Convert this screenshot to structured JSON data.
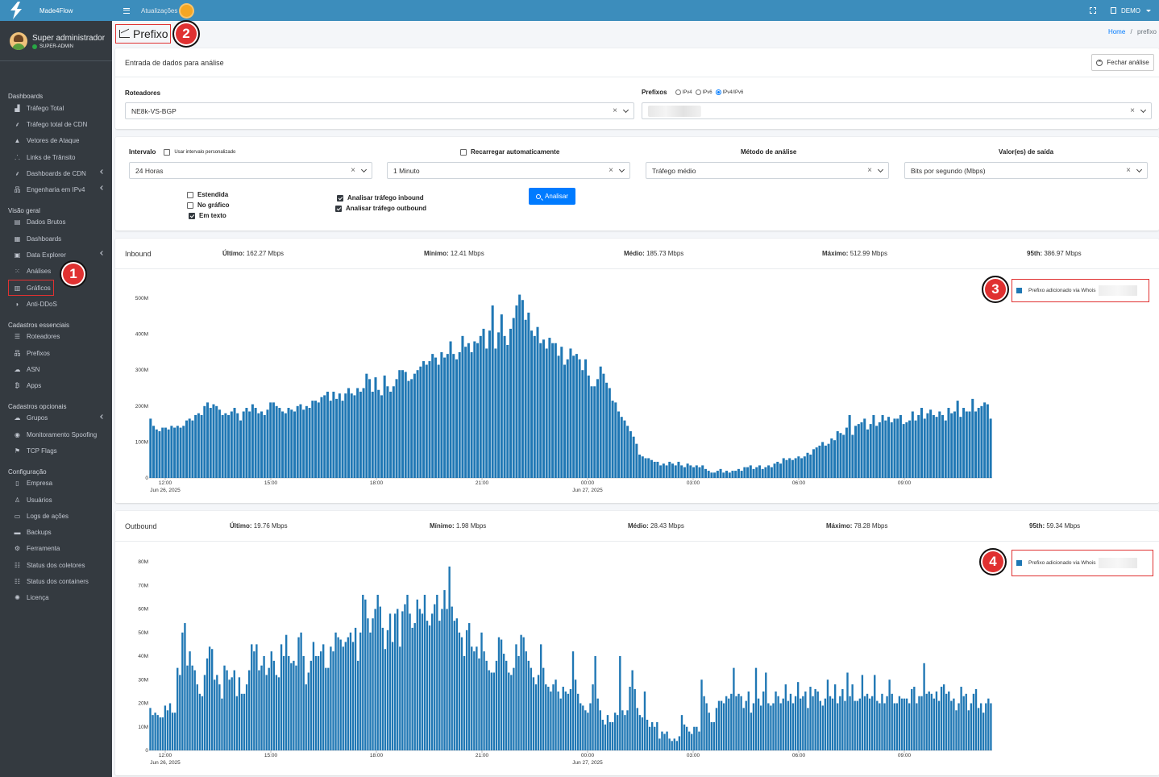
{
  "brand": {
    "name": "Made4Flow"
  },
  "user": {
    "name": "Super administrador",
    "role": "SUPER-ADMIN"
  },
  "topbar": {
    "updates_label": "Atualizações",
    "account_label": "DEMO"
  },
  "sidebar": {
    "sections": [
      {
        "header": "Dashboards",
        "items": [
          {
            "label": "Tráfego Total",
            "icon": "chart-area-icon",
            "chevron": false
          },
          {
            "label": "Tráfego total de CDN",
            "icon": "broadcast-icon",
            "chevron": false
          },
          {
            "label": "Vetores de Ataque",
            "icon": "warning-icon",
            "chevron": false
          },
          {
            "label": "Links de Trânsito",
            "icon": "network-icon",
            "chevron": false
          },
          {
            "label": "Dashboards de CDN",
            "icon": "broadcast-icon",
            "chevron": true
          },
          {
            "label": "Engenharia em IPv4",
            "icon": "sitemap-icon",
            "chevron": true
          }
        ]
      },
      {
        "header": "Visão geral",
        "items": [
          {
            "label": "Dados Brutos",
            "icon": "file-icon",
            "chevron": false
          },
          {
            "label": "Dashboards",
            "icon": "calendar-icon",
            "chevron": false
          },
          {
            "label": "Data Explorer",
            "icon": "explorer-icon",
            "chevron": true
          },
          {
            "label": "Análises",
            "icon": "grid-icon",
            "chevron": false
          },
          {
            "label": "Gráficos",
            "icon": "bar-chart-icon",
            "chevron": false,
            "highlighted": true
          },
          {
            "label": "Anti-DDoS",
            "icon": "shield-icon",
            "chevron": false
          }
        ]
      },
      {
        "header": "Cadastros essenciais",
        "items": [
          {
            "label": "Roteadores",
            "icon": "server-icon",
            "chevron": false
          },
          {
            "label": "Prefixos",
            "icon": "sitemap-icon",
            "chevron": false
          },
          {
            "label": "ASN",
            "icon": "cloud-icon",
            "chevron": false
          },
          {
            "label": "Apps",
            "icon": "bitcoin-icon",
            "chevron": false
          }
        ]
      },
      {
        "header": "Cadastros opcionais",
        "items": [
          {
            "label": "Grupos",
            "icon": "cloud-group-icon",
            "chevron": true
          },
          {
            "label": "Monitoramento Spoofing",
            "icon": "user-secret-icon",
            "chevron": false
          },
          {
            "label": "TCP Flags",
            "icon": "flag-icon",
            "chevron": false
          }
        ]
      },
      {
        "header": "Configuração",
        "items": [
          {
            "label": "Empresa",
            "icon": "building-icon",
            "chevron": false
          },
          {
            "label": "Usuários",
            "icon": "user-icon",
            "chevron": false
          },
          {
            "label": "Logs de ações",
            "icon": "folder-icon",
            "chevron": false
          },
          {
            "label": "Backups",
            "icon": "database-icon",
            "chevron": false
          },
          {
            "label": "Ferramenta",
            "icon": "gear-icon",
            "chevron": false
          },
          {
            "label": "Status dos coletores",
            "icon": "list-icon",
            "chevron": false
          },
          {
            "label": "Status dos containers",
            "icon": "list-icon",
            "chevron": false
          },
          {
            "label": "Licença",
            "icon": "certificate-icon",
            "chevron": false
          }
        ]
      }
    ]
  },
  "page": {
    "title": "Prefixo",
    "breadcrumb_home": "Home",
    "breadcrumb_sep": "/",
    "breadcrumb_current": "prefixo"
  },
  "annotations": [
    "1",
    "2",
    "3",
    "4"
  ],
  "form": {
    "header": "Entrada de dados para análise",
    "close_button": "Fechar análise",
    "routers_label": "Roteadores",
    "routers_value": "NE8k-VS-BGP",
    "prefixes_label": "Prefixos",
    "prefix_options": [
      "IPv4",
      "IPv6",
      "IPv4/IPv6"
    ],
    "prefix_selected": "IPv4/IPv6",
    "interval_label": "Intervalo",
    "custom_interval_label": "Usar intervalo personalizado",
    "interval_value": "24 Horas",
    "reload_label": "Recarregar automaticamente",
    "reload_value": "1 Minuto",
    "method_label": "Método de análise",
    "method_value": "Tráfego médio",
    "output_label": "Valor(es) de saída",
    "output_value": "Bits por segundo (Mbps)",
    "options": [
      {
        "label": "Estendida",
        "checked": false
      },
      {
        "label": "No gráfico",
        "checked": false
      },
      {
        "label": "Em texto",
        "checked": true
      }
    ],
    "traffic_options": [
      {
        "label": "Analisar tráfego inbound",
        "checked": true
      },
      {
        "label": "Analisar tráfego outbound",
        "checked": true
      }
    ],
    "analyze_button": "Analisar"
  },
  "inbound": {
    "title": "Inbound",
    "stats": [
      {
        "label": "Último:",
        "value": "162.27 Mbps"
      },
      {
        "label": "Mínimo:",
        "value": "12.41 Mbps"
      },
      {
        "label": "Médio:",
        "value": "185.73 Mbps"
      },
      {
        "label": "Máximo:",
        "value": "512.99 Mbps"
      },
      {
        "label": "95th:",
        "value": "386.97 Mbps"
      }
    ],
    "legend": "Prefixo adicionado via Whois"
  },
  "outbound": {
    "title": "Outbound",
    "stats": [
      {
        "label": "Último:",
        "value": "19.76 Mbps"
      },
      {
        "label": "Mínimo:",
        "value": "1.98 Mbps"
      },
      {
        "label": "Médio:",
        "value": "28.43 Mbps"
      },
      {
        "label": "Máximo:",
        "value": "78.28 Mbps"
      },
      {
        "label": "95th:",
        "value": "59.34 Mbps"
      }
    ],
    "legend": "Prefixo adicionado via Whois"
  },
  "chart_data": [
    {
      "type": "bar",
      "title": "Inbound",
      "unit": "Mbps",
      "color": "#1f77b4",
      "ylim": [
        0,
        500
      ],
      "yticks": [
        "0",
        "100M",
        "200M",
        "300M",
        "400M",
        "500M"
      ],
      "xticks": [
        "12:00",
        "15:00",
        "18:00",
        "21:00",
        "00:00",
        "03:00",
        "06:00",
        "09:00"
      ],
      "xtick_sublabels": [
        "Jun 26, 2025",
        "",
        "",
        "",
        "Jun 27, 2025",
        "",
        "",
        ""
      ],
      "legend": [
        "Prefixo adicionado via Whois"
      ],
      "values": [
        165,
        145,
        135,
        130,
        140,
        140,
        135,
        145,
        140,
        145,
        140,
        145,
        160,
        165,
        160,
        175,
        180,
        175,
        200,
        210,
        195,
        205,
        200,
        190,
        175,
        180,
        175,
        185,
        195,
        180,
        160,
        185,
        195,
        185,
        205,
        195,
        180,
        185,
        175,
        190,
        210,
        210,
        200,
        195,
        185,
        180,
        195,
        190,
        185,
        200,
        205,
        190,
        200,
        195,
        215,
        215,
        210,
        225,
        230,
        240,
        215,
        240,
        220,
        235,
        215,
        235,
        250,
        235,
        230,
        250,
        240,
        250,
        290,
        275,
        240,
        280,
        245,
        230,
        285,
        255,
        240,
        255,
        275,
        300,
        300,
        295,
        270,
        275,
        290,
        300,
        310,
        325,
        315,
        325,
        345,
        335,
        315,
        350,
        335,
        345,
        380,
        345,
        330,
        350,
        395,
        365,
        375,
        350,
        380,
        375,
        395,
        415,
        360,
        410,
        480,
        360,
        405,
        455,
        395,
        370,
        415,
        445,
        480,
        510,
        495,
        440,
        460,
        410,
        395,
        420,
        375,
        385,
        360,
        390,
        375,
        375,
        340,
        365,
        315,
        330,
        360,
        340,
        345,
        330,
        300,
        330,
        285,
        255,
        255,
        275,
        310,
        290,
        265,
        250,
        215,
        210,
        185,
        170,
        160,
        145,
        130,
        115,
        95,
        65,
        60,
        55,
        55,
        50,
        45,
        45,
        35,
        40,
        35,
        45,
        40,
        35,
        45,
        35,
        30,
        40,
        35,
        30,
        35,
        30,
        35,
        25,
        20,
        15,
        15,
        20,
        25,
        15,
        20,
        15,
        20,
        20,
        25,
        20,
        30,
        30,
        35,
        25,
        30,
        35,
        25,
        30,
        35,
        30,
        40,
        45,
        40,
        55,
        50,
        55,
        50,
        55,
        60,
        55,
        60,
        70,
        65,
        80,
        85,
        90,
        100,
        90,
        95,
        110,
        105,
        130,
        125,
        120,
        140,
        175,
        120,
        145,
        150,
        155,
        165,
        135,
        150,
        175,
        145,
        155,
        175,
        160,
        170,
        155,
        165,
        165,
        175,
        150,
        155,
        160,
        185,
        160,
        175,
        195,
        165,
        180,
        190,
        175,
        170,
        185,
        175,
        160,
        195,
        180,
        185,
        215,
        170,
        195,
        185,
        185,
        220,
        185,
        195,
        200,
        210,
        205,
        165
      ]
    },
    {
      "type": "bar",
      "title": "Outbound",
      "unit": "Mbps",
      "color": "#1f77b4",
      "ylim": [
        0,
        80
      ],
      "yticks": [
        "0",
        "10M",
        "20M",
        "30M",
        "40M",
        "50M",
        "60M",
        "70M",
        "80M"
      ],
      "xticks": [
        "12:00",
        "15:00",
        "18:00",
        "21:00",
        "00:00",
        "03:00",
        "06:00",
        "09:00"
      ],
      "xtick_sublabels": [
        "Jun 26, 2025",
        "",
        "",
        "",
        "Jun 27, 2025",
        "",
        "",
        ""
      ],
      "legend": [
        "Prefixo adicionado via Whois"
      ],
      "values": [
        18,
        15,
        16,
        15,
        14,
        14,
        19,
        17,
        20,
        16,
        16,
        35,
        32,
        50,
        54,
        36,
        42,
        36,
        34,
        28,
        24,
        23,
        32,
        39,
        44,
        43,
        30,
        32,
        28,
        22,
        36,
        34,
        30,
        31,
        34,
        23,
        31,
        24,
        24,
        28,
        34,
        45,
        42,
        45,
        34,
        36,
        40,
        32,
        35,
        42,
        38,
        32,
        31,
        45,
        40,
        49,
        40,
        37,
        38,
        36,
        48,
        50,
        40,
        28,
        33,
        38,
        46,
        40,
        40,
        42,
        45,
        35,
        35,
        44,
        42,
        50,
        48,
        47,
        44,
        46,
        48,
        50,
        46,
        52,
        38,
        50,
        66,
        64,
        56,
        50,
        56,
        60,
        66,
        61,
        52,
        43,
        51,
        58,
        46,
        58,
        60,
        44,
        59,
        62,
        66,
        58,
        52,
        54,
        64,
        60,
        58,
        66,
        55,
        53,
        58,
        62,
        66,
        55,
        60,
        68,
        60,
        78,
        61,
        55,
        56,
        50,
        48,
        40,
        51,
        54,
        44,
        42,
        44,
        39,
        50,
        42,
        38,
        34,
        33,
        33,
        38,
        48,
        47,
        41,
        38,
        33,
        32,
        35,
        45,
        40,
        49,
        48,
        42,
        38,
        35,
        31,
        28,
        32,
        45,
        35,
        28,
        27,
        25,
        28,
        30,
        25,
        22,
        27,
        25,
        24,
        26,
        42,
        30,
        24,
        20,
        19,
        17,
        16,
        20,
        28,
        40,
        22,
        17,
        13,
        11,
        15,
        12,
        12,
        16,
        15,
        40,
        17,
        15,
        17,
        27,
        34,
        26,
        18,
        15,
        14,
        25,
        13,
        10,
        12,
        10,
        12,
        5,
        8,
        7,
        8,
        5,
        4,
        5,
        4,
        6,
        15,
        11,
        10,
        8,
        7,
        10,
        10,
        8,
        30,
        23,
        20,
        16,
        12,
        12,
        18,
        21,
        21,
        20,
        23,
        22,
        24,
        35,
        23,
        24,
        23,
        18,
        21,
        25,
        16,
        20,
        35,
        22,
        19,
        25,
        33,
        20,
        19,
        20,
        25,
        23,
        20,
        22,
        28,
        21,
        24,
        20,
        23,
        29,
        22,
        23,
        25,
        18,
        27,
        23,
        26,
        25,
        21,
        19,
        22,
        30,
        23,
        22,
        28,
        20,
        23,
        26,
        21,
        33,
        23,
        28,
        21,
        21,
        22,
        32,
        23,
        24,
        22,
        23,
        32,
        21,
        20,
        24,
        20,
        23,
        30,
        24,
        20,
        20,
        23,
        22,
        22,
        22,
        20,
        26,
        27,
        20,
        23,
        23,
        37,
        24,
        25,
        24,
        22,
        25,
        21,
        27,
        28,
        24,
        25,
        21,
        22,
        17,
        20,
        27,
        23,
        24,
        17,
        20,
        24,
        26,
        18,
        20,
        16,
        20,
        22,
        20
      ]
    }
  ]
}
